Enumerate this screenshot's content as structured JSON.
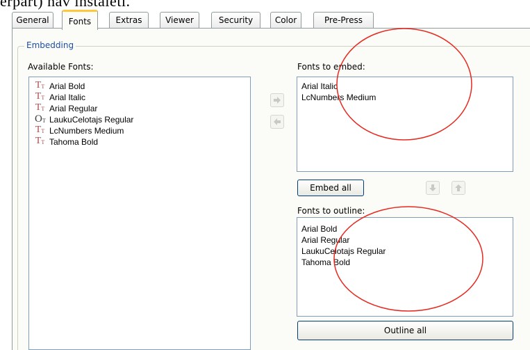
{
  "cropped_heading": "erpart) nav instalēti.",
  "tabs": [
    "General",
    "Fonts",
    "Extras",
    "Viewer",
    "Security",
    "Color",
    "Pre-Press"
  ],
  "active_tab": "Fonts",
  "embedding": {
    "group_title": "Embedding",
    "available_label": "Available Fonts:",
    "available_fonts": [
      {
        "name": "Arial Bold",
        "icon": "truetype-font-icon"
      },
      {
        "name": "Arial Italic",
        "icon": "truetype-font-icon"
      },
      {
        "name": "Arial Regular",
        "icon": "truetype-font-icon"
      },
      {
        "name": "LaukuCelotajs Regular",
        "icon": "opentype-font-icon"
      },
      {
        "name": "LcNumbers Medium",
        "icon": "truetype-font-icon"
      },
      {
        "name": "Tahoma Bold",
        "icon": "truetype-font-icon"
      }
    ],
    "embed_label": "Fonts to embed:",
    "embed_fonts": [
      "Arial Italic",
      "LcNumbers Medium"
    ],
    "embed_all_label": "Embed all",
    "outline_label": "Fonts to outline:",
    "outline_fonts": [
      "Arial Bold",
      "Arial Regular",
      "LaukuCelotajs Regular",
      "Tahoma Bold"
    ],
    "outline_all_label": "Outline all"
  },
  "colors": {
    "tab_highlight": "#ffc83c",
    "group_title": "#1f4ea0",
    "annotation_circle": "#e8281e"
  }
}
